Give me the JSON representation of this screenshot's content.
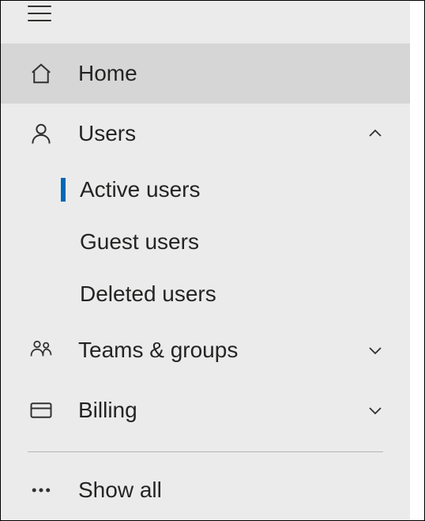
{
  "sidebar": {
    "items": [
      {
        "label": "Home"
      },
      {
        "label": "Users",
        "expanded": true,
        "children": [
          {
            "label": "Active users",
            "active": true
          },
          {
            "label": "Guest users"
          },
          {
            "label": "Deleted users"
          }
        ]
      },
      {
        "label": "Teams & groups",
        "expanded": false
      },
      {
        "label": "Billing",
        "expanded": false
      },
      {
        "label": "Show all"
      }
    ]
  },
  "colors": {
    "accent": "#0067b8"
  }
}
